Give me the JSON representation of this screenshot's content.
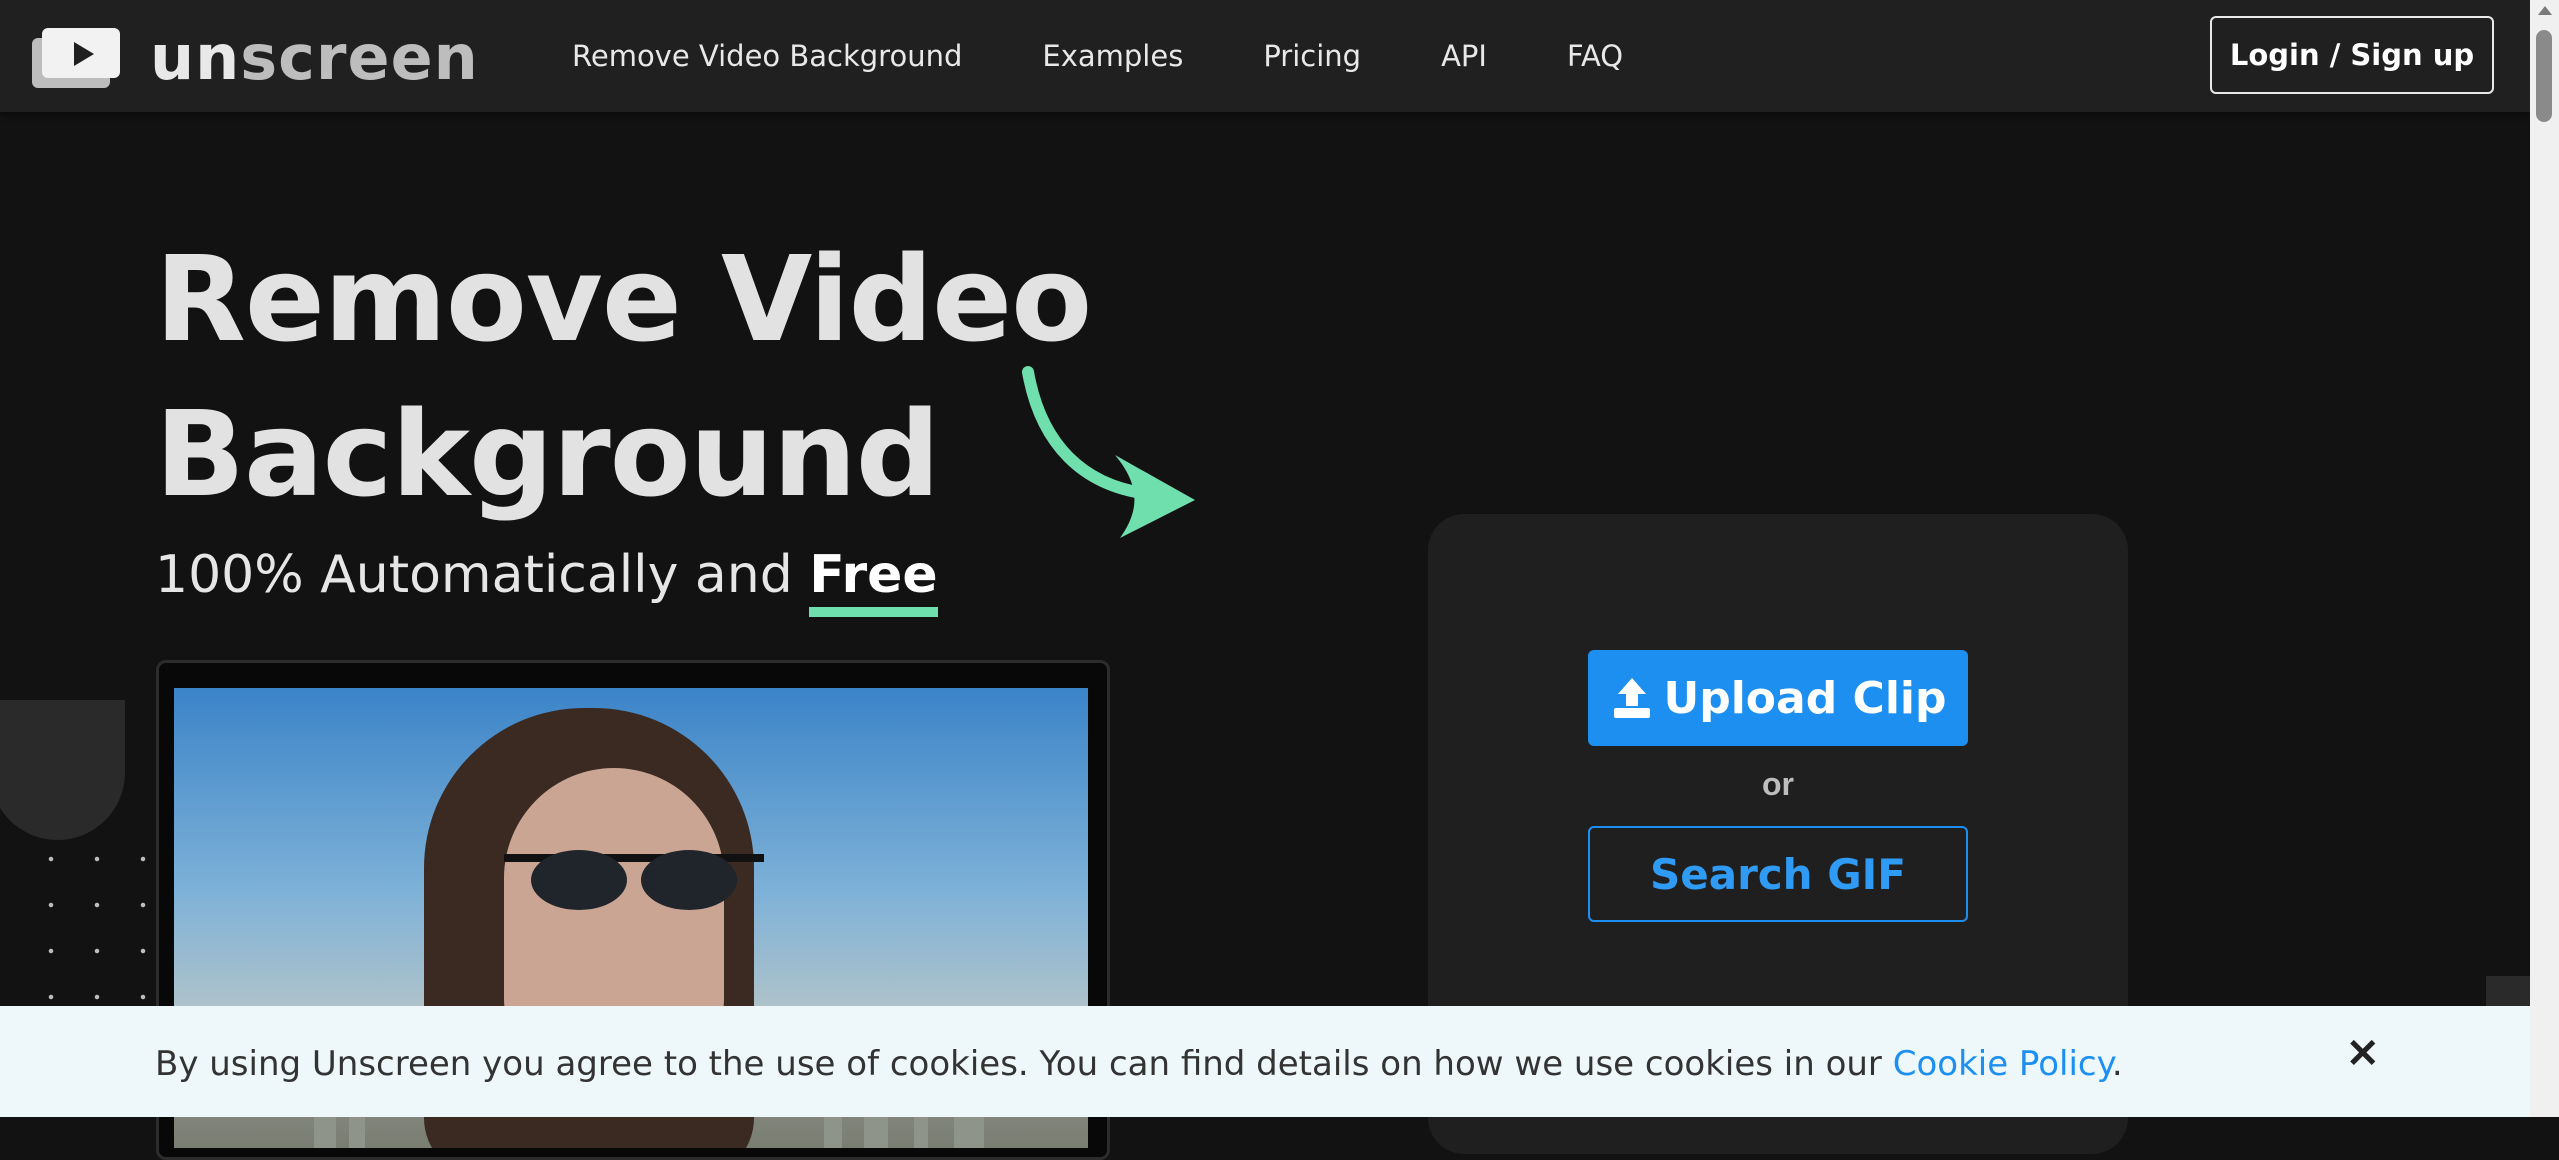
{
  "header": {
    "logo_text_bold": "un",
    "logo_text_light": "screen",
    "nav": [
      {
        "label": "Remove Video Background"
      },
      {
        "label": "Examples"
      },
      {
        "label": "Pricing"
      },
      {
        "label": "API"
      },
      {
        "label": "FAQ"
      }
    ],
    "login_label": "Login / Sign up"
  },
  "hero": {
    "title_line1": "Remove Video",
    "title_line2": "Background",
    "subtitle_prefix": "100% Automatically and ",
    "subtitle_emphasis": "Free"
  },
  "upload": {
    "upload_label": "Upload Clip",
    "or_label": "or",
    "search_label": "Search GIF"
  },
  "cookie": {
    "text": "By using Unscreen you agree to the use of cookies. You can find details on how we use cookies in our ",
    "link_label": "Cookie Policy",
    "suffix": ".",
    "close_label": "✕"
  },
  "colors": {
    "accent": "#1c8ff0",
    "highlight": "#6fdfae",
    "background": "#121212",
    "header": "#202020"
  }
}
